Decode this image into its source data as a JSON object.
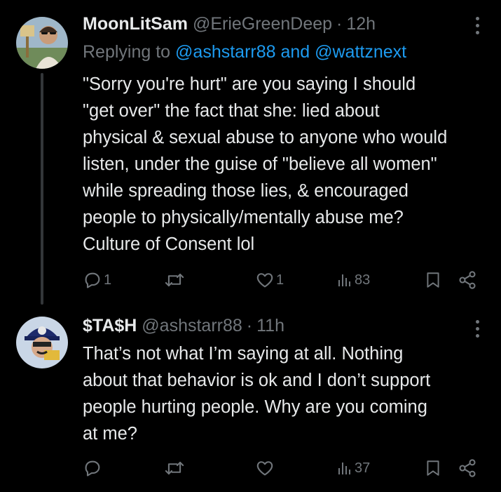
{
  "tweets": [
    {
      "display_name": "MoonLitSam",
      "handle": "@ErieGreenDeep",
      "separator": "·",
      "time": "12h",
      "replying_prefix": "Replying to ",
      "replying_to": "@ashstarr88 and @wattznext",
      "text": "\"Sorry you're hurt\" are you saying I should\n\"get over\" the fact that she: lied about\nphysical & sexual abuse to anyone who would\nlisten, under the guise of \"believe all women\"\nwhile spreading those lies, & encouraged\npeople to physically/mentally abuse me?\nCulture of Consent lol",
      "reply_count": "1",
      "retweet_count": "",
      "like_count": "1",
      "views": "83"
    },
    {
      "display_name": "$TA$H",
      "handle": "@ashstarr88",
      "separator": "·",
      "time": "11h",
      "text": "That’s not what I’m saying at all. Nothing\nabout that behavior is ok and I don’t support\npeople hurting people. Why are you coming\nat me?",
      "reply_count": "",
      "retweet_count": "",
      "like_count": "",
      "views": "37"
    }
  ],
  "icons": {
    "reply": "reply-icon",
    "retweet": "retweet-icon",
    "like": "heart-icon",
    "views": "views-chart-icon",
    "bookmark": "bookmark-icon",
    "share": "share-icon",
    "more": "more-options-icon"
  },
  "colors": {
    "background": "#000000",
    "text": "#e7e9ea",
    "muted": "#71767b",
    "link": "#1d9bf0",
    "thread_line": "#333639"
  }
}
